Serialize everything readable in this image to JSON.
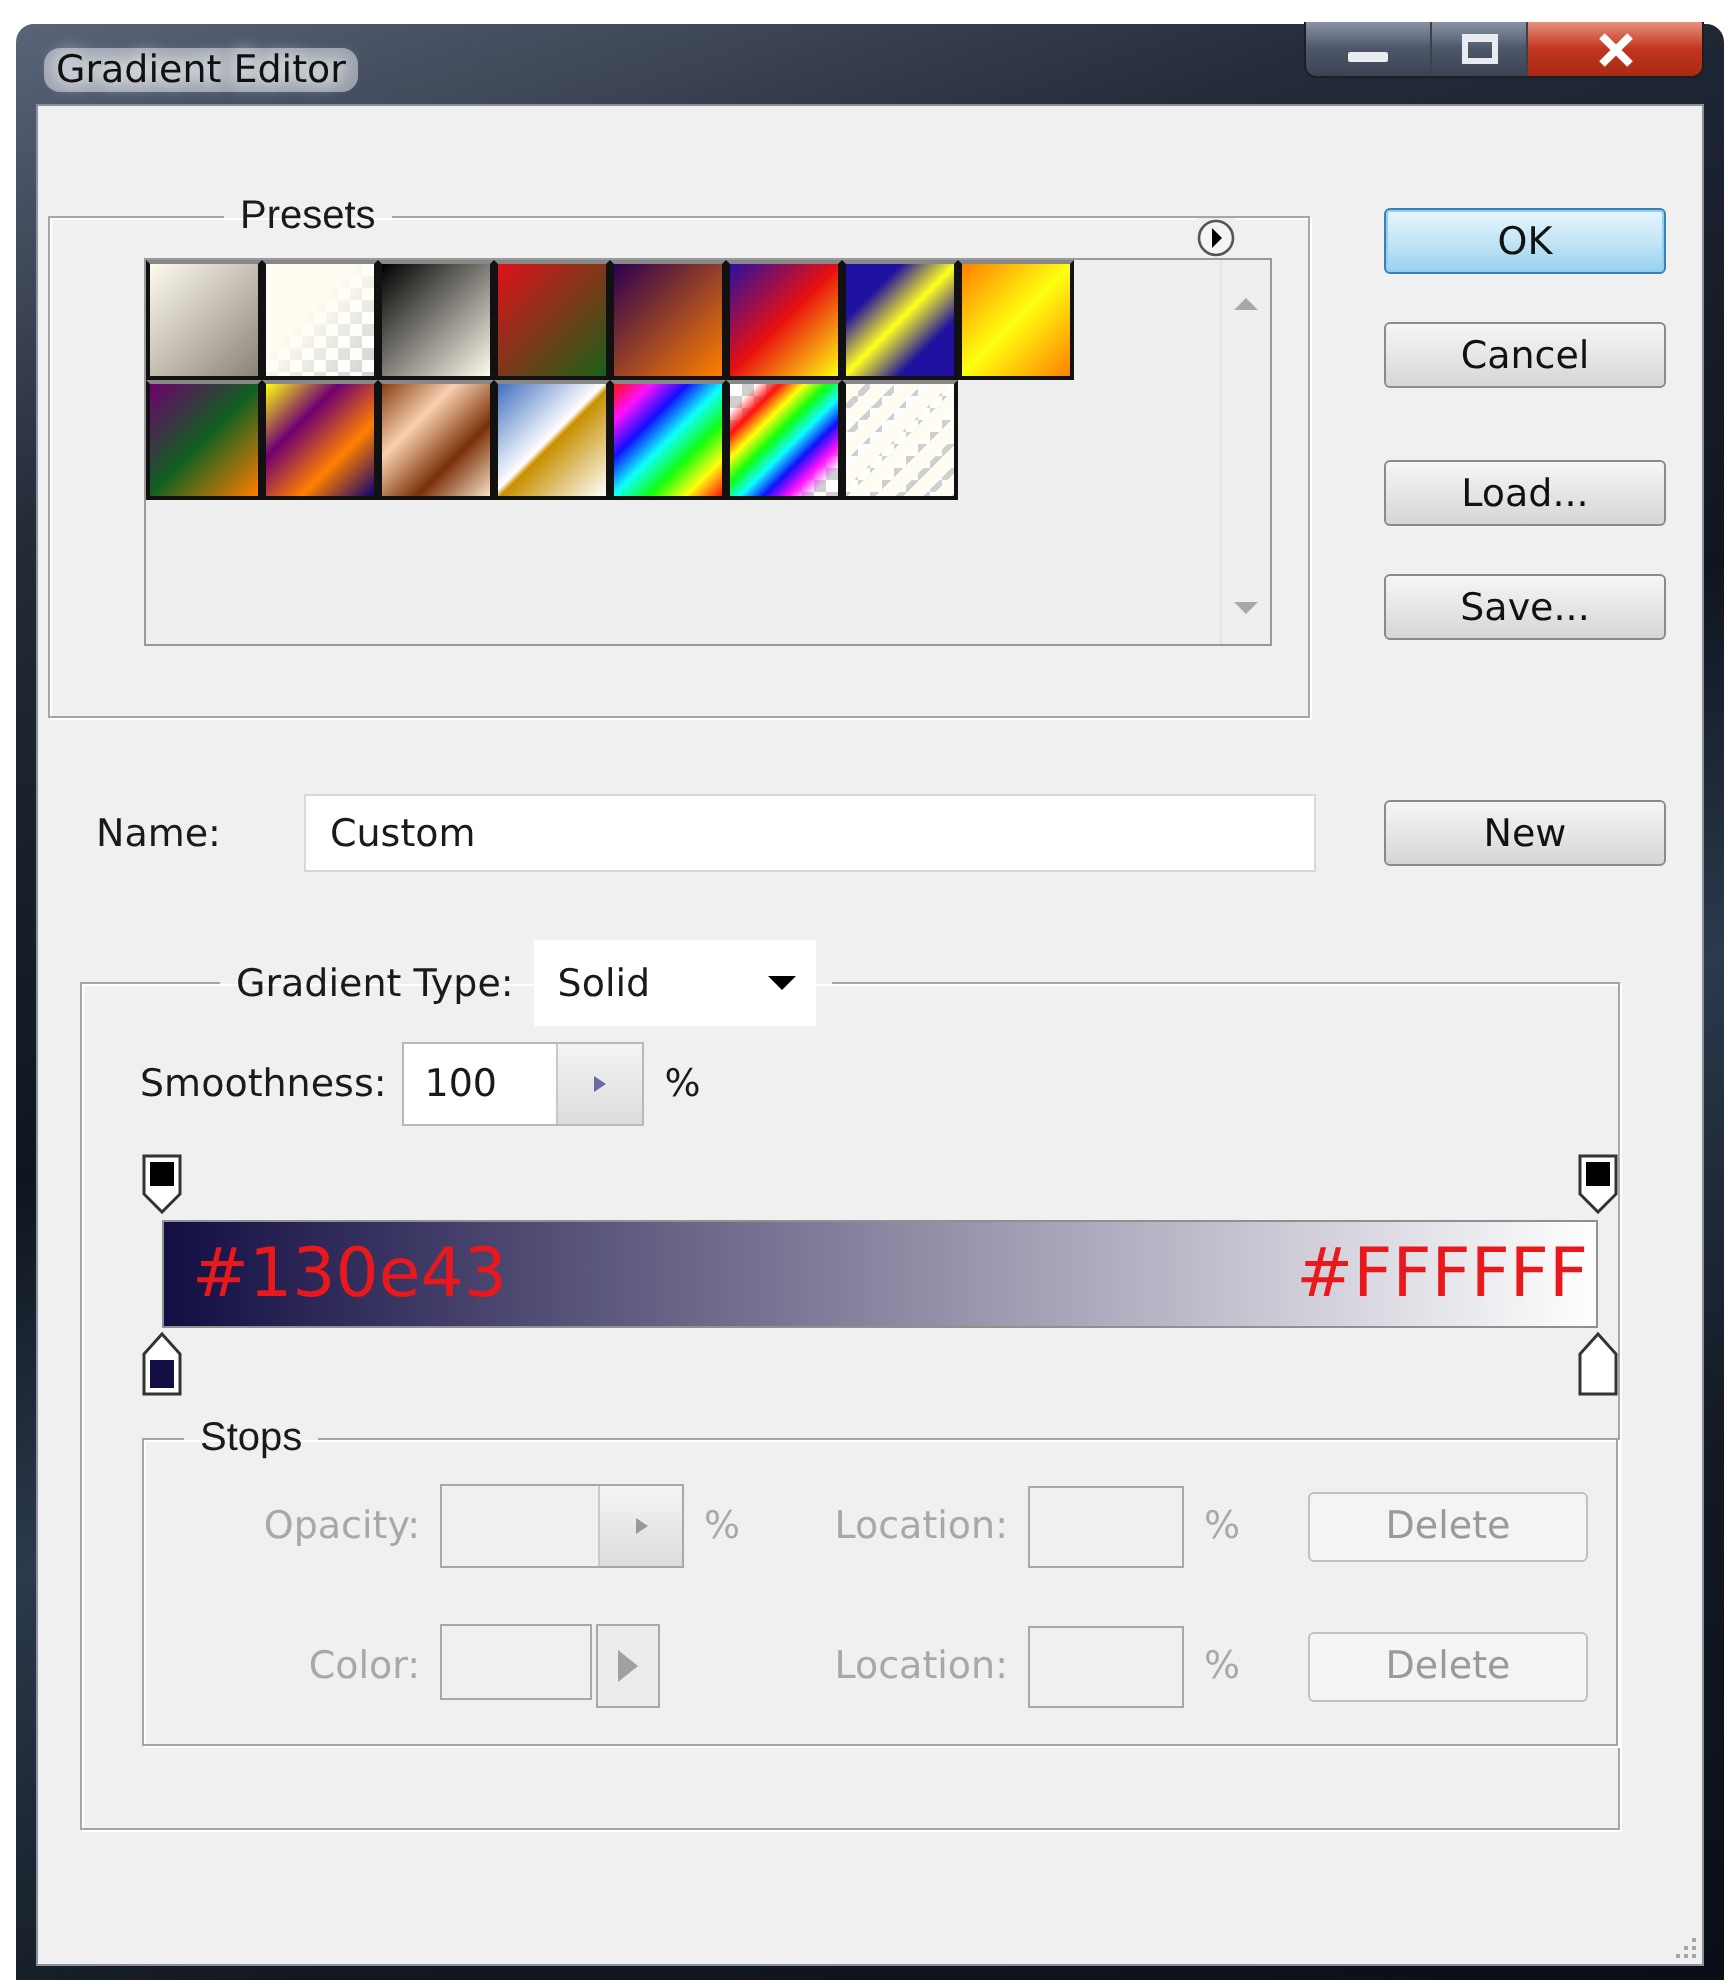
{
  "window": {
    "title": "Gradient Editor"
  },
  "presets": {
    "title": "Presets",
    "swatches": [
      {
        "kind": "opaque"
      },
      {
        "kind": "transparent"
      },
      {
        "kind": "opaque"
      },
      {
        "kind": "opaque"
      },
      {
        "kind": "opaque"
      },
      {
        "kind": "opaque"
      },
      {
        "kind": "opaque"
      },
      {
        "kind": "opaque"
      },
      {
        "kind": "opaque"
      },
      {
        "kind": "opaque"
      },
      {
        "kind": "opaque"
      },
      {
        "kind": "opaque"
      },
      {
        "kind": "opaque"
      },
      {
        "kind": "transparent"
      },
      {
        "kind": "transparent"
      }
    ]
  },
  "buttons": [
    {
      "label": "OK",
      "default": true
    },
    {
      "label": "Cancel",
      "default": false
    },
    {
      "label": "Load...",
      "default": false
    },
    {
      "label": "Save...",
      "default": false
    }
  ],
  "name": {
    "label": "Name:",
    "value": "Custom",
    "button": "New"
  },
  "gradient": {
    "type_label": "Gradient Type:",
    "type_value": "Solid",
    "smoothness_label": "Smoothness:",
    "smoothness_value": "100",
    "smoothness_unit": "%",
    "color_stops": [
      {
        "color": "#130e43"
      },
      {
        "color": "#ffffff"
      }
    ],
    "annotations": [
      "#130e43",
      "#FFFFFF"
    ]
  },
  "stops": {
    "title": "Stops",
    "rows": [
      {
        "kind": "stepper",
        "label": "Opacity:",
        "unit": "%",
        "location_label": "Location:",
        "location_unit": "%",
        "button": "Delete",
        "disabled": true
      },
      {
        "kind": "swatch",
        "label": "Color:",
        "location_label": "Location:",
        "location_unit": "%",
        "button": "Delete",
        "disabled": true
      }
    ]
  }
}
